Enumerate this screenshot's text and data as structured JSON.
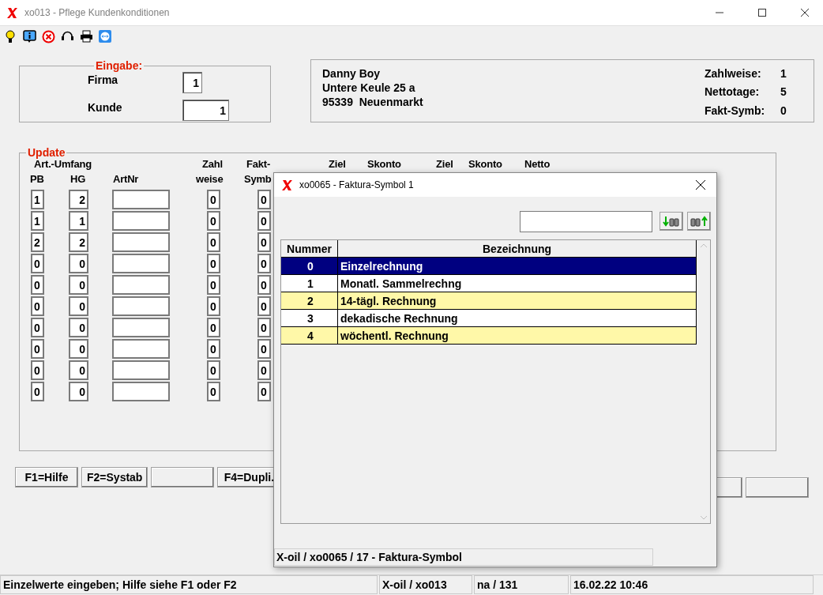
{
  "window": {
    "title": "xo013 - Pflege Kundenkonditionen"
  },
  "eingabe": {
    "legend": "Eingabe:",
    "fields": [
      {
        "label": "Firma",
        "value": "1"
      },
      {
        "label": "Kunde",
        "value": "1"
      }
    ]
  },
  "address": {
    "lines": [
      "Danny Boy",
      "Untere Keule 25 a",
      "95339  Neuenmarkt"
    ],
    "info": [
      {
        "label": "Zahlweise:",
        "value": "1"
      },
      {
        "label": "Nettotage:",
        "value": "5"
      },
      {
        "label": "Fakt-Symb:",
        "value": "0"
      }
    ]
  },
  "update": {
    "legend": "Update",
    "header_line_1": [
      "Art.-Umfang",
      "Zahl",
      "Fakt-",
      "Ziel",
      "Skonto",
      "Ziel",
      "Skonto",
      "Netto"
    ],
    "header_line_2": [
      "PB",
      "HG",
      "ArtNr",
      "weise",
      "Symb"
    ],
    "rows": [
      {
        "pb": "1",
        "hg": "2",
        "zahlweise": "0",
        "fakt_symb": "0"
      },
      {
        "pb": "1",
        "hg": "1",
        "zahlweise": "0",
        "fakt_symb": "0"
      },
      {
        "pb": "2",
        "hg": "2",
        "zahlweise": "0",
        "fakt_symb": "0"
      },
      {
        "pb": "0",
        "hg": "0",
        "zahlweise": "0",
        "fakt_symb": "0"
      },
      {
        "pb": "0",
        "hg": "0",
        "zahlweise": "0",
        "fakt_symb": "0"
      },
      {
        "pb": "0",
        "hg": "0",
        "zahlweise": "0",
        "fakt_symb": "0"
      },
      {
        "pb": "0",
        "hg": "0",
        "zahlweise": "0",
        "fakt_symb": "0"
      },
      {
        "pb": "0",
        "hg": "0",
        "zahlweise": "0",
        "fakt_symb": "0"
      },
      {
        "pb": "0",
        "hg": "0",
        "zahlweise": "0",
        "fakt_symb": "0"
      },
      {
        "pb": "0",
        "hg": "0",
        "zahlweise": "0",
        "fakt_symb": "0"
      }
    ]
  },
  "function_keys": [
    {
      "kind": "labeled",
      "label": "F1=Hilfe"
    },
    {
      "kind": "labeled",
      "label": "F2=Systab"
    },
    {
      "kind": "blank"
    },
    {
      "kind": "labeled",
      "label": "F4=Dupli."
    }
  ],
  "dialog": {
    "title": "xo0065 - Faktura-Symbol 1",
    "columns": [
      "Nummer",
      "Bezeichnung"
    ],
    "rows": [
      {
        "nummer": "0",
        "bezeichnung": "Einzelrechnung",
        "selected": true
      },
      {
        "nummer": "1",
        "bezeichnung": "Monatl. Sammelrechng",
        "selected": false
      },
      {
        "nummer": "2",
        "bezeichnung": "14-tägl. Rechnung",
        "selected": false
      },
      {
        "nummer": "3",
        "bezeichnung": "dekadische Rechnung",
        "selected": false
      },
      {
        "nummer": "4",
        "bezeichnung": "wöchentl. Rechnung",
        "selected": false
      }
    ],
    "status": "X-oil / xo0065 / 17 - Faktura-Symbol"
  },
  "status_bar": [
    "Einzelwerte eingeben; Hilfe siehe F1 oder F2",
    "X-oil / xo013",
    "na / 131",
    "16.02.22 10:46"
  ]
}
